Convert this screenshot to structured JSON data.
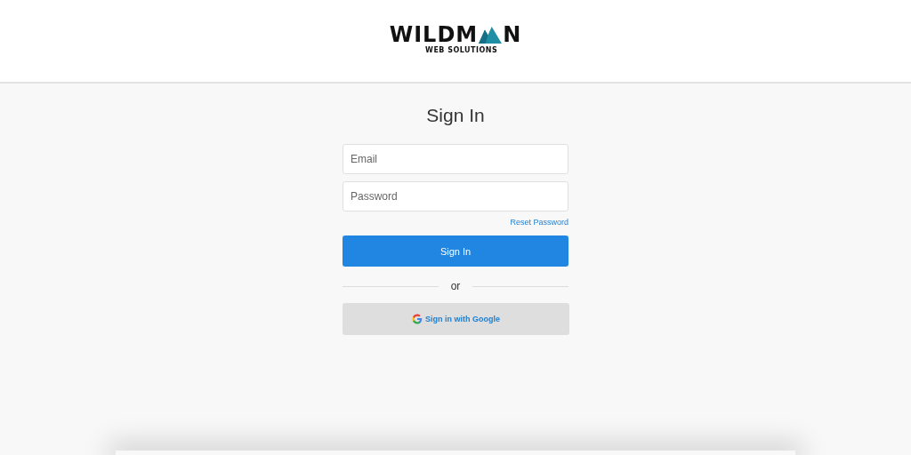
{
  "logo": {
    "name_start": "WILDM",
    "name_end": "N",
    "tagline": "WEB SOLUTIONS"
  },
  "title": "Sign In",
  "fields": [
    {
      "placeholder": "Email"
    },
    {
      "placeholder": "Password"
    }
  ],
  "reset_link": "Reset Password",
  "sign_in_button": "Sign In",
  "divider_text": "or",
  "google_button": "Sign in with Google"
}
